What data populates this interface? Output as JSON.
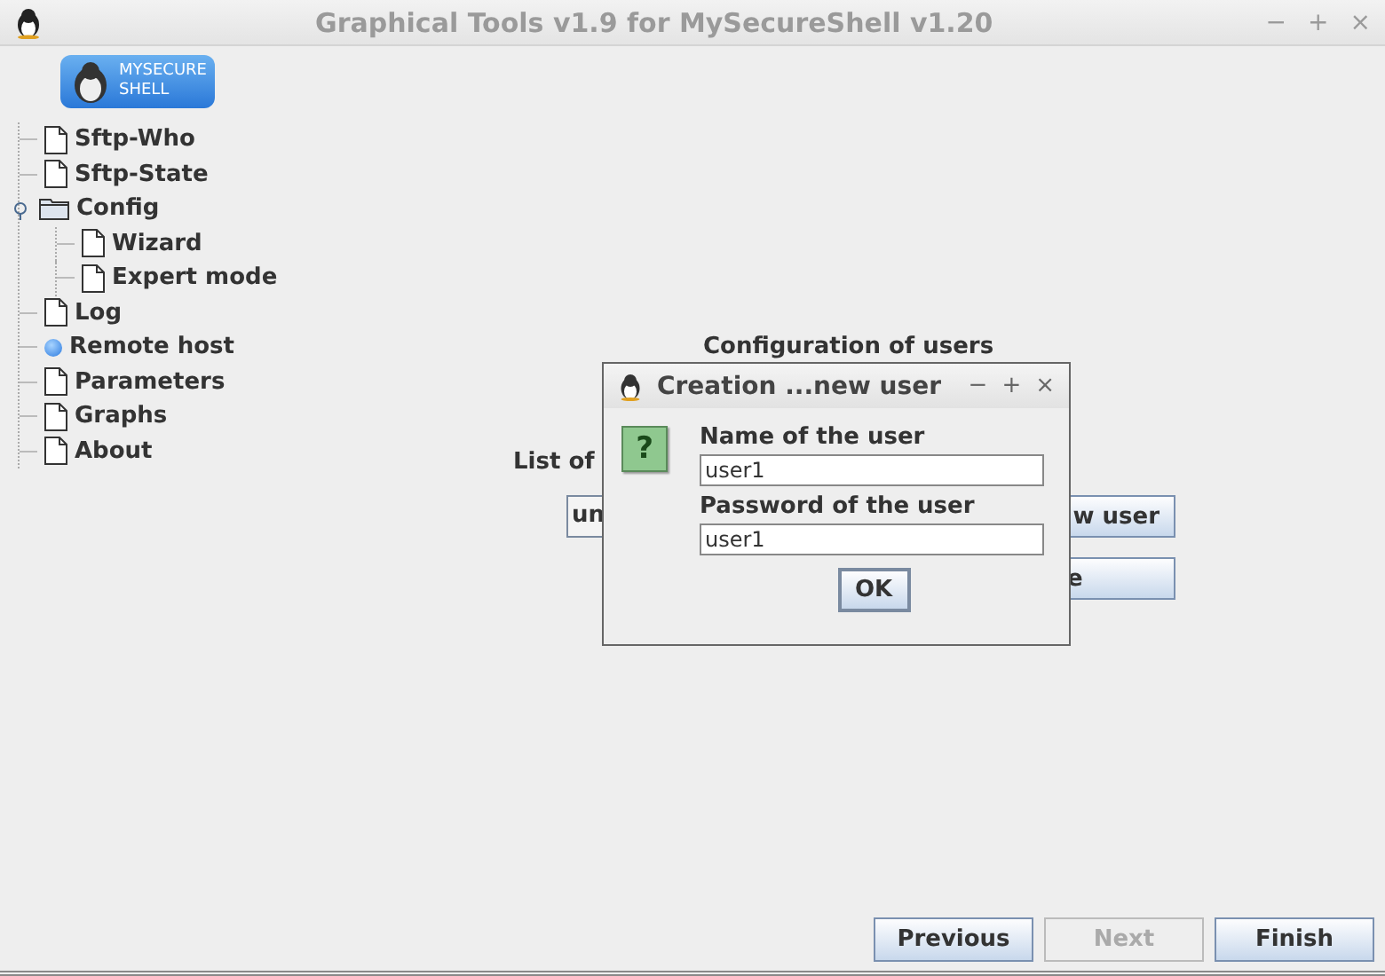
{
  "window": {
    "title": "Graphical Tools v1.9 for MySecureShell v1.20",
    "controls": [
      "−",
      "+",
      "×"
    ]
  },
  "logo": {
    "lines": [
      "MYSECURE",
      "SHELL"
    ]
  },
  "tree": [
    {
      "label": "Sftp-Who",
      "kind": "doc"
    },
    {
      "label": "Sftp-State",
      "kind": "doc"
    },
    {
      "label": "Config",
      "kind": "folder",
      "expanded": true,
      "children": [
        {
          "label": "Wizard",
          "kind": "doc"
        },
        {
          "label": "Expert mode",
          "kind": "doc"
        }
      ]
    },
    {
      "label": "Log",
      "kind": "doc"
    },
    {
      "label": "Remote host",
      "kind": "bullet"
    },
    {
      "label": "Parameters",
      "kind": "doc"
    },
    {
      "label": "Graphs",
      "kind": "doc"
    },
    {
      "label": "About",
      "kind": "doc"
    }
  ],
  "panel": {
    "title": "Configuration of users",
    "list_label": "List of",
    "user_combo": "un",
    "buttons": [
      "w user",
      "e"
    ]
  },
  "dialog": {
    "title": "Creation ...new user",
    "controls": [
      "−",
      "+",
      "×"
    ],
    "icon": "?",
    "fields": [
      {
        "label": "Name of the user",
        "value": "user1"
      },
      {
        "label": "Password of the user",
        "value": "user1"
      }
    ],
    "ok": "OK"
  },
  "footer": [
    {
      "label": "Previous",
      "disabled": false
    },
    {
      "label": "Next",
      "disabled": true
    },
    {
      "label": "Finish",
      "disabled": false
    }
  ]
}
